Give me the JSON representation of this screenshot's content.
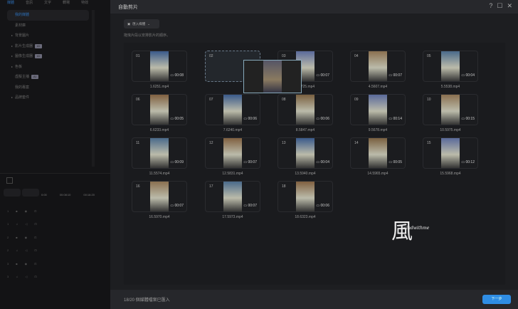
{
  "tabs": [
    "媒體",
    "音訊",
    "文字",
    "轉場",
    "特效"
  ],
  "sidebar": [
    {
      "label": "我的媒體",
      "arrow": false,
      "ai": false,
      "active": true
    },
    {
      "label": "素材庫",
      "arrow": false,
      "ai": false
    },
    {
      "label": "背景圖片",
      "arrow": true,
      "ai": false
    },
    {
      "label": "影片生成器",
      "arrow": true,
      "ai": true
    },
    {
      "label": "圖像生成器",
      "arrow": true,
      "ai": true
    },
    {
      "label": "色板",
      "arrow": true,
      "ai": false
    },
    {
      "label": "虛擬主播",
      "arrow": false,
      "ai": true
    },
    {
      "label": "我的專案",
      "arrow": false,
      "ai": false
    },
    {
      "label": "品牌套件",
      "arrow": true,
      "ai": false
    }
  ],
  "ai_badge": "AI",
  "timeline": {
    "ticks": [
      "0:00",
      "00:08:10",
      "00:16:20"
    ],
    "tracks": [
      "1",
      "1",
      "2",
      "2",
      "3",
      "3"
    ]
  },
  "dialog": {
    "title": "自動剪片",
    "import_label": "匯入媒體",
    "hint": "拖曳片段以安排影片的順序。",
    "status": "18/20 個媒體檔案已匯入",
    "next_label": "下一步"
  },
  "clips": [
    {
      "num": "01",
      "dur": "00:08",
      "file": "1.6251.mp4"
    },
    {
      "num": "02",
      "dur": "",
      "file": ""
    },
    {
      "num": "03",
      "dur": "00:07",
      "file": "3.5725.mp4"
    },
    {
      "num": "04",
      "dur": "00:07",
      "file": "4.5607.mp4"
    },
    {
      "num": "05",
      "dur": "00:04",
      "file": "5.5538.mp4"
    },
    {
      "num": "06",
      "dur": "00:05",
      "file": "6.6233.mp4"
    },
    {
      "num": "07",
      "dur": "00:06",
      "file": "7.6240.mp4"
    },
    {
      "num": "08",
      "dur": "00:06",
      "file": "8.5847.mp4"
    },
    {
      "num": "09",
      "dur": "00:14",
      "file": "9.5678.mp4"
    },
    {
      "num": "10",
      "dur": "00:15",
      "file": "10.5975.mp4"
    },
    {
      "num": "11",
      "dur": "00:09",
      "file": "11.5574.mp4"
    },
    {
      "num": "12",
      "dur": "00:07",
      "file": "12.5831.mp4"
    },
    {
      "num": "13",
      "dur": "00:04",
      "file": "13.5940.mp4"
    },
    {
      "num": "14",
      "dur": "00:05",
      "file": "14.5965.mp4"
    },
    {
      "num": "15",
      "dur": "00:12",
      "file": "15.5968.mp4"
    },
    {
      "num": "16",
      "dur": "00:07",
      "file": "16.5970.mp4"
    },
    {
      "num": "17",
      "dur": "00:07",
      "file": "17.5973.mp4"
    },
    {
      "num": "18",
      "dur": "00:06",
      "file": "18.6323.mp4"
    }
  ],
  "watermark": "windwithme"
}
